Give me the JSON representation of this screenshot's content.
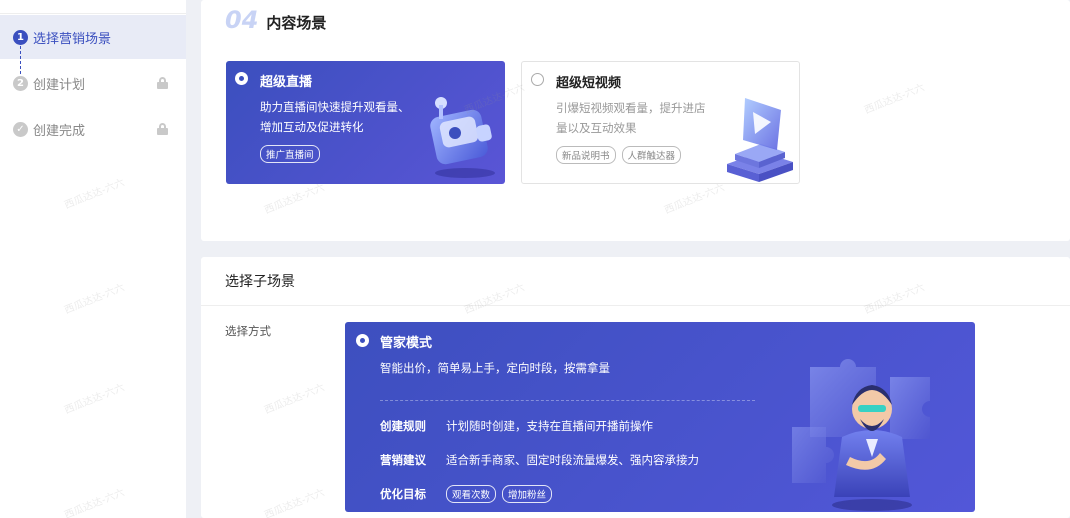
{
  "sidebar": {
    "steps": [
      {
        "num": "1",
        "label": "选择营销场景"
      },
      {
        "num": "2",
        "label": "创建计划"
      },
      {
        "num": "✓",
        "label": "创建完成"
      }
    ]
  },
  "content_scene": {
    "number": "04",
    "title": "内容场景",
    "cards": [
      {
        "title": "超级直播",
        "desc": "助力直播间快速提升观看量、增加互动及促进转化",
        "tags": [
          "推广直播间"
        ]
      },
      {
        "title": "超级短视频",
        "desc": "引爆短视频观看量，提升进店量以及互动效果",
        "tags": [
          "新品说明书",
          "人群触达器"
        ]
      }
    ]
  },
  "sub_scene": {
    "title": "选择子场景",
    "field_label": "选择方式",
    "mode": {
      "title": "管家模式",
      "desc": "智能出价，简单易上手，定向时段，按需拿量",
      "rows": [
        {
          "key": "创建规则",
          "value": "计划随时创建，支持在直播间开播前操作"
        },
        {
          "key": "营销建议",
          "value": "适合新手商家、固定时段流量爆发、强内容承接力"
        },
        {
          "key": "优化目标",
          "tags": [
            "观看次数",
            "增加粉丝"
          ]
        }
      ]
    }
  },
  "watermark": "西瓜达达-六六",
  "colors": {
    "accent": "#3a4fbf",
    "card_gradient_start": "#3b4fbe",
    "card_gradient_end": "#5a55d6"
  }
}
